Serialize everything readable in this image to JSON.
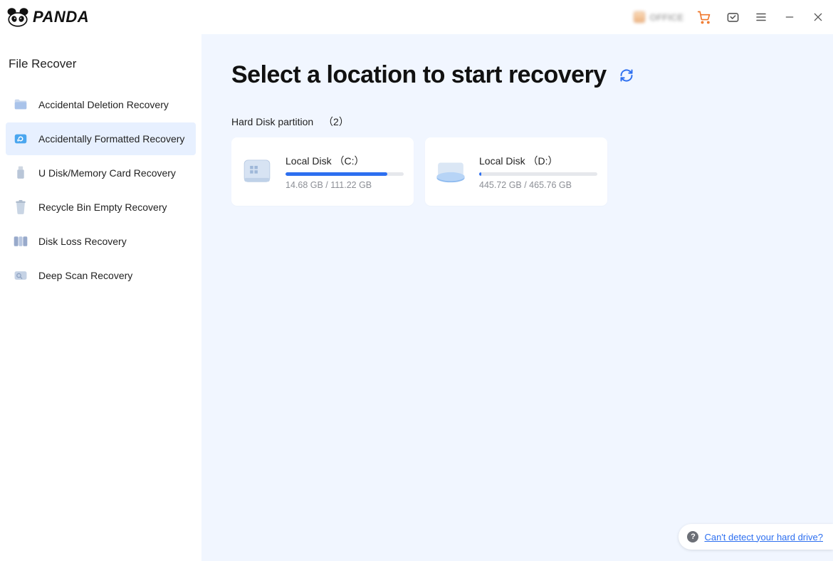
{
  "brand": {
    "name": "PANDA"
  },
  "titlebar": {
    "user_label": "OFFICE",
    "icons": {
      "cart": "cart-icon",
      "subscribe": "tv-icon",
      "menu": "menu-icon",
      "minimize": "minimize-icon",
      "close": "close-icon"
    }
  },
  "sidebar": {
    "title": "File Recover",
    "items": [
      {
        "label": "Accidental Deletion Recovery",
        "icon": "folder-icon",
        "active": false
      },
      {
        "label": "Accidentally Formatted Recovery",
        "icon": "disk-refresh-icon",
        "active": true
      },
      {
        "label": "U Disk/Memory Card Recovery",
        "icon": "usb-icon",
        "active": false
      },
      {
        "label": "Recycle Bin Empty Recovery",
        "icon": "recycle-bin-icon",
        "active": false
      },
      {
        "label": "Disk Loss Recovery",
        "icon": "partition-icon",
        "active": false
      },
      {
        "label": "Deep Scan Recovery",
        "icon": "deep-scan-icon",
        "active": false
      }
    ]
  },
  "main": {
    "title": "Select a location to start recovery",
    "section_label": "Hard Disk partition",
    "section_count": "（2）",
    "disks": [
      {
        "name": "Local Disk （C:）",
        "size_text": "14.68 GB / 111.22 GB",
        "used_pct": 86,
        "kind": "system"
      },
      {
        "name": "Local Disk （D:）",
        "size_text": "445.72 GB / 465.76 GB",
        "used_pct": 2,
        "kind": "data"
      }
    ],
    "help_link": "Can't detect your hard drive?"
  }
}
